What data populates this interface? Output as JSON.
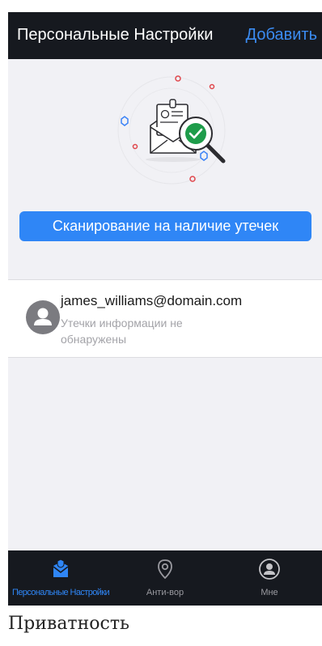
{
  "header": {
    "title": "Персональные Настройки",
    "add_label": "Добавить"
  },
  "scan": {
    "button_label": "Сканирование на наличие утечек"
  },
  "account": {
    "email": "james_williams@domain.com",
    "status": "Утечки информации не обнаружены"
  },
  "tabs": [
    {
      "label": "Персональные Настройки",
      "icon": "envelope-shield-icon",
      "active": true
    },
    {
      "label": "Анти-вор",
      "icon": "location-pin-icon",
      "active": false
    },
    {
      "label": "Мне",
      "icon": "user-circle-icon",
      "active": false
    }
  ],
  "caption": "Приватность",
  "colors": {
    "accent": "#2f86f6",
    "header_bg": "#16191f",
    "content_bg": "#f1f1f5",
    "check_green": "#1e9c4a"
  }
}
